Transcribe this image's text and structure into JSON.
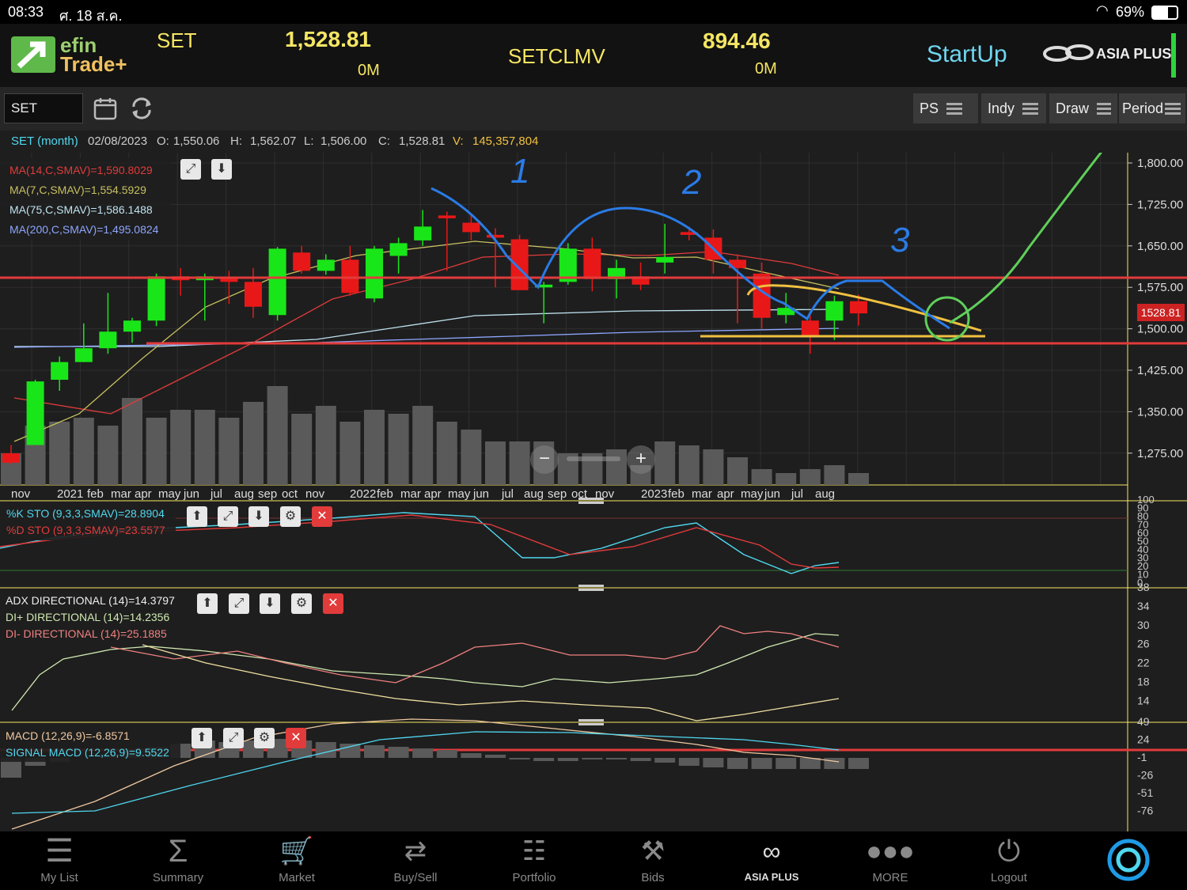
{
  "statusbar": {
    "time": "08:33",
    "date": "ศ. 18 ส.ค.",
    "battery": "69%"
  },
  "header": {
    "logo_top": "efin",
    "logo_bottom": "Trade+",
    "index1": {
      "name": "SET",
      "value": "1,528.81",
      "volume": "0M"
    },
    "index2": {
      "name": "SETCLMV",
      "value": "894.46",
      "volume": "0M"
    },
    "startup": "StartUp",
    "brand": "ASIA PLUS"
  },
  "toolbar": {
    "symbol": "SET",
    "buttons": [
      "PS",
      "Indy",
      "Draw",
      "Period"
    ]
  },
  "ohlc": {
    "title": "SET (month)",
    "date": "02/08/2023",
    "o_label": "O:",
    "o": "1,550.06",
    "h_label": "H:",
    "h": "1,562.07",
    "l_label": "L:",
    "l": "1,506.00",
    "c_label": "C:",
    "c": "1,528.81",
    "v_label": "V:",
    "v": "145,357,804"
  },
  "legend_ma": [
    {
      "text": "MA(14,C,SMAV)=1,590.8029",
      "color": "#e23b3b"
    },
    {
      "text": "MA(7,C,SMAV)=1,554.5929",
      "color": "#c8c060"
    },
    {
      "text": "MA(75,C,SMAV)=1,586.1488",
      "color": "#bfe3f0"
    },
    {
      "text": "MA(200,C,SMAV)=1,495.0824",
      "color": "#8ea6ff"
    }
  ],
  "price_axis": [
    "1,800.00",
    "1,725.00",
    "1,650.00",
    "1,575.00",
    "1,500.00",
    "1,425.00",
    "1,350.00",
    "1,275.00"
  ],
  "last_price_tag": "1528.81",
  "x_labels": [
    "nov",
    "2021",
    "feb",
    "mar",
    "apr",
    "may",
    "jun",
    "jul",
    "aug",
    "sep",
    "oct",
    "nov",
    "2022",
    "feb",
    "mar",
    "apr",
    "may",
    "jun",
    "jul",
    "aug",
    "sep",
    "oct",
    "nov",
    "2023",
    "feb",
    "mar",
    "apr",
    "may",
    "jun",
    "jul",
    "aug"
  ],
  "annotations": [
    "1",
    "2",
    "3"
  ],
  "sto": {
    "k": "%K STO (9,3,3,SMAV)=28.8904",
    "d": "%D STO (9,3,3,SMAV)=23.5577",
    "axis": [
      "100",
      "90",
      "80",
      "70",
      "60",
      "50",
      "40",
      "30",
      "20",
      "10",
      "0"
    ]
  },
  "adx": {
    "adx": "ADX DIRECTIONAL (14)=14.3797",
    "dip": "DI+ DIRECTIONAL (14)=14.2356",
    "dim": "DI- DIRECTIONAL (14)=25.1885",
    "axis": [
      "38",
      "34",
      "30",
      "26",
      "22",
      "18",
      "14"
    ]
  },
  "macd": {
    "macd": "MACD (12,26,9)=-6.8571",
    "signal": "SIGNAL MACD (12,26,9)=9.5522",
    "axis": [
      "49",
      "24",
      "-1",
      "-26",
      "-51",
      "-76"
    ]
  },
  "tabs": [
    "My List",
    "Summary",
    "Market",
    "Buy/Sell",
    "Portfolio",
    "Bids",
    "ASIA PLUS",
    "MORE",
    "Logout"
  ],
  "colors": {
    "up": "#19e619",
    "down": "#e81818",
    "accent_yellow": "#f5e663",
    "cyan": "#4fd8f0"
  }
}
